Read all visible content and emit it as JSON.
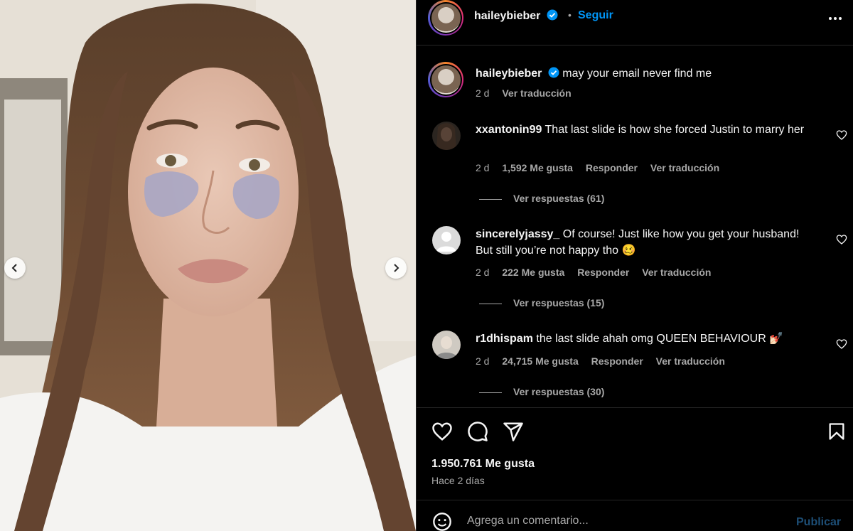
{
  "post": {
    "username": "haileybieber",
    "follow_label": "Seguir",
    "separator": "•",
    "caption": {
      "username": "haileybieber",
      "text": "may your email never find me",
      "time": "2 d",
      "translate": "Ver traducción"
    }
  },
  "comments": [
    {
      "username": "xxantonin99",
      "text": "That last slide is how she forced Justin to marry her",
      "time": "2 d",
      "likes": "1,592 Me gusta",
      "reply": "Responder",
      "translate": "Ver traducción",
      "view_replies": "Ver respuestas (61)"
    },
    {
      "username": "sincerelyjassy_",
      "text": "Of course! Just like how you get your husband! But still you’re not happy tho 🥴",
      "time": "2 d",
      "likes": "222 Me gusta",
      "reply": "Responder",
      "translate": "Ver traducción",
      "view_replies": "Ver respuestas (15)"
    },
    {
      "username": "r1dhispam",
      "text": "the last slide ahah omg QUEEN BEHAVIOUR 💅🏻",
      "time": "2 d",
      "likes": "24,715 Me gusta",
      "reply": "Responder",
      "translate": "Ver traducción",
      "view_replies": "Ver respuestas (30)"
    }
  ],
  "stats": {
    "likes": "1.950.761 Me gusta",
    "posted": "Hace 2 días"
  },
  "composer": {
    "placeholder": "Agrega un comentario...",
    "post_label": "Publicar"
  },
  "icons": [
    "verified-badge-icon",
    "more-options-icon",
    "heart-icon",
    "comment-icon",
    "share-icon",
    "bookmark-icon",
    "emoji-icon",
    "chevron-left-icon",
    "chevron-right-icon"
  ],
  "colors": {
    "background": "#000000",
    "link_blue": "#0095f6",
    "secondary_text": "#a8a8a8",
    "divider": "#262626"
  }
}
